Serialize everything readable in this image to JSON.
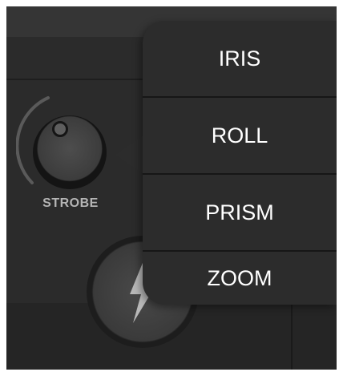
{
  "knob": {
    "label": "STROBE"
  },
  "menu": {
    "items": [
      {
        "label": "IRIS"
      },
      {
        "label": "ROLL"
      },
      {
        "label": "PRISM"
      },
      {
        "label": "ZOOM"
      }
    ]
  },
  "colors": {
    "background": "#2b2b2b",
    "menu_background": "#2c2c2c",
    "menu_text": "#ffffff",
    "knob_label": "#b5b5b5",
    "arc": "#5a5a5a"
  },
  "icons": {
    "flash": "lightning-bolt-icon",
    "knob_indicator": "knob-indicator-dot"
  }
}
